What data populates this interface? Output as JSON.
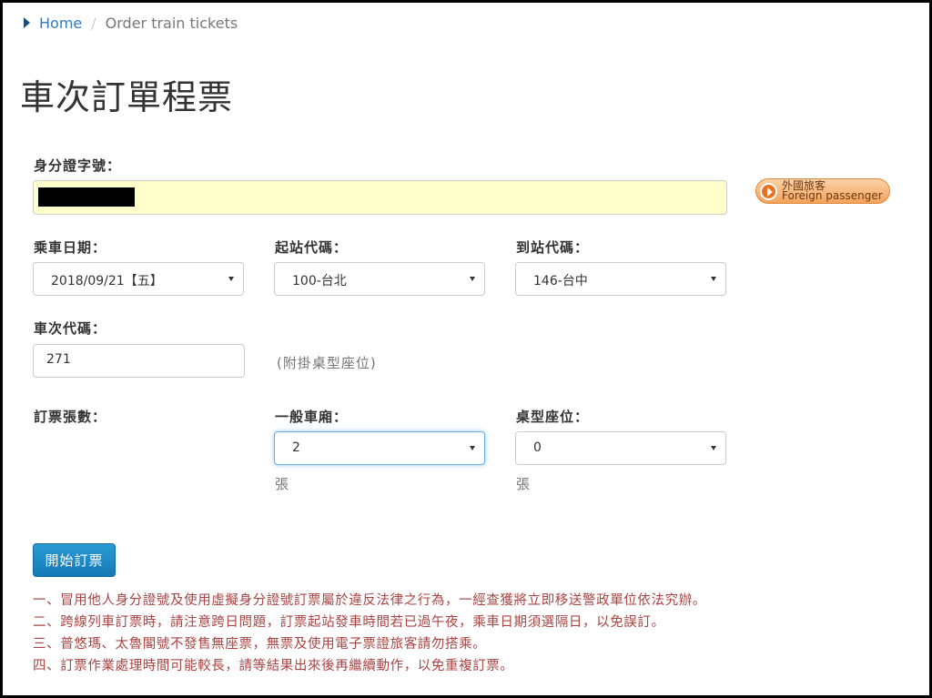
{
  "breadcrumb": {
    "home": "Home",
    "separator": "/",
    "current": "Order train tickets"
  },
  "page_title": "車次訂單程票",
  "id_field": {
    "label": "身分證字號：",
    "value": ""
  },
  "foreign_passenger": {
    "zh": "外國旅客",
    "en": "Foreign passenger"
  },
  "travel_date": {
    "label": "乘車日期：",
    "selected": "2018/09/21【五】"
  },
  "from_station": {
    "label": "起站代碼：",
    "selected": "100-台北"
  },
  "to_station": {
    "label": "到站代碼：",
    "selected": "146-台中"
  },
  "train_no": {
    "label": "車次代碼：",
    "value": "271",
    "note": "(附掛桌型座位)"
  },
  "ticket_count": {
    "label": "訂票張數：",
    "normal": {
      "label": "一般車廂：",
      "selected": "2",
      "unit": "張"
    },
    "table": {
      "label": "桌型座位：",
      "selected": "0",
      "unit": "張"
    }
  },
  "submit_label": "開始訂票",
  "notices": [
    "一、冒用他人身分證號及使用虛擬身分證號訂票屬於違反法律之行為，一經查獲將立即移送警政單位依法究辦。",
    "二、跨線列車訂票時，請注意跨日問題，訂票起站發車時間若已過午夜，乘車日期須選隔日，以免誤訂。",
    "三、普悠瑪、太魯閣號不發售無座票，無票及使用電子票證旅客請勿搭乘。",
    "四、訂票作業處理時間可能較長，請等結果出來後再繼續動作，以免重複訂票。"
  ],
  "colors": {
    "accent": "#337ab7",
    "button": "#1b87c4",
    "warning": "#a94442",
    "id_field_bg": "#ffffcc"
  }
}
